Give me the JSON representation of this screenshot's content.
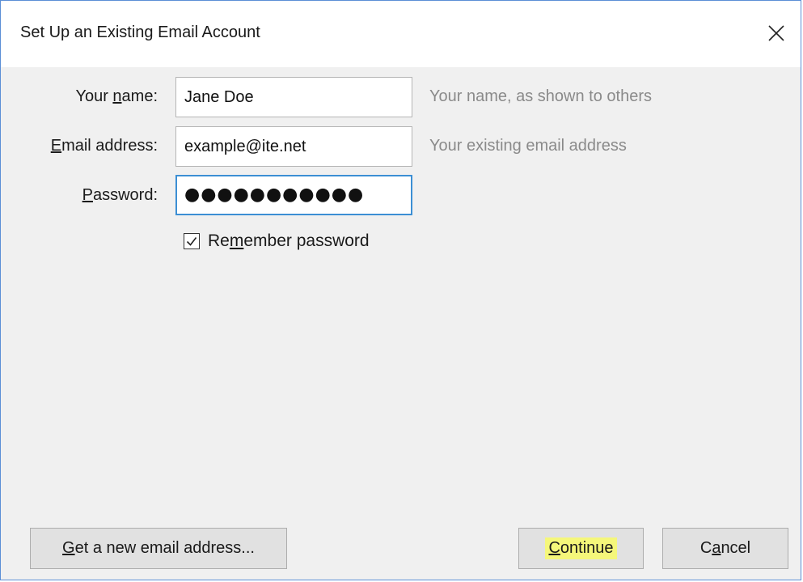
{
  "dialog": {
    "title": "Set Up an Existing Email Account",
    "close_icon": "close-icon"
  },
  "form": {
    "name": {
      "label_pre": "Your ",
      "label_key": "n",
      "label_post": "ame:",
      "value": "Jane Doe",
      "hint": "Your name, as shown to others"
    },
    "email": {
      "label_pre": "",
      "label_key": "E",
      "label_post": "mail address:",
      "value": "example@ite.net",
      "hint": "Your existing email address"
    },
    "password": {
      "label_pre": "",
      "label_key": "P",
      "label_post": "assword:",
      "value": "●●●●●●●●●●●"
    },
    "remember": {
      "label_pre": "Re",
      "label_key": "m",
      "label_post": "ember password",
      "checked": true
    }
  },
  "buttons": {
    "get_new": {
      "label_pre": "",
      "label_key": "G",
      "label_post": "et a new email address..."
    },
    "continue": {
      "label_pre": "",
      "label_key": "C",
      "label_post": "ontinue",
      "highlight_color": "#f5f77a"
    },
    "cancel": {
      "label_pre": "C",
      "label_key": "a",
      "label_post": "ncel"
    }
  },
  "colors": {
    "window_border": "#5b8fd6",
    "focus_border": "#3c8fd4",
    "hint_text": "#8a8a8a",
    "background": "#f0f0f0"
  }
}
